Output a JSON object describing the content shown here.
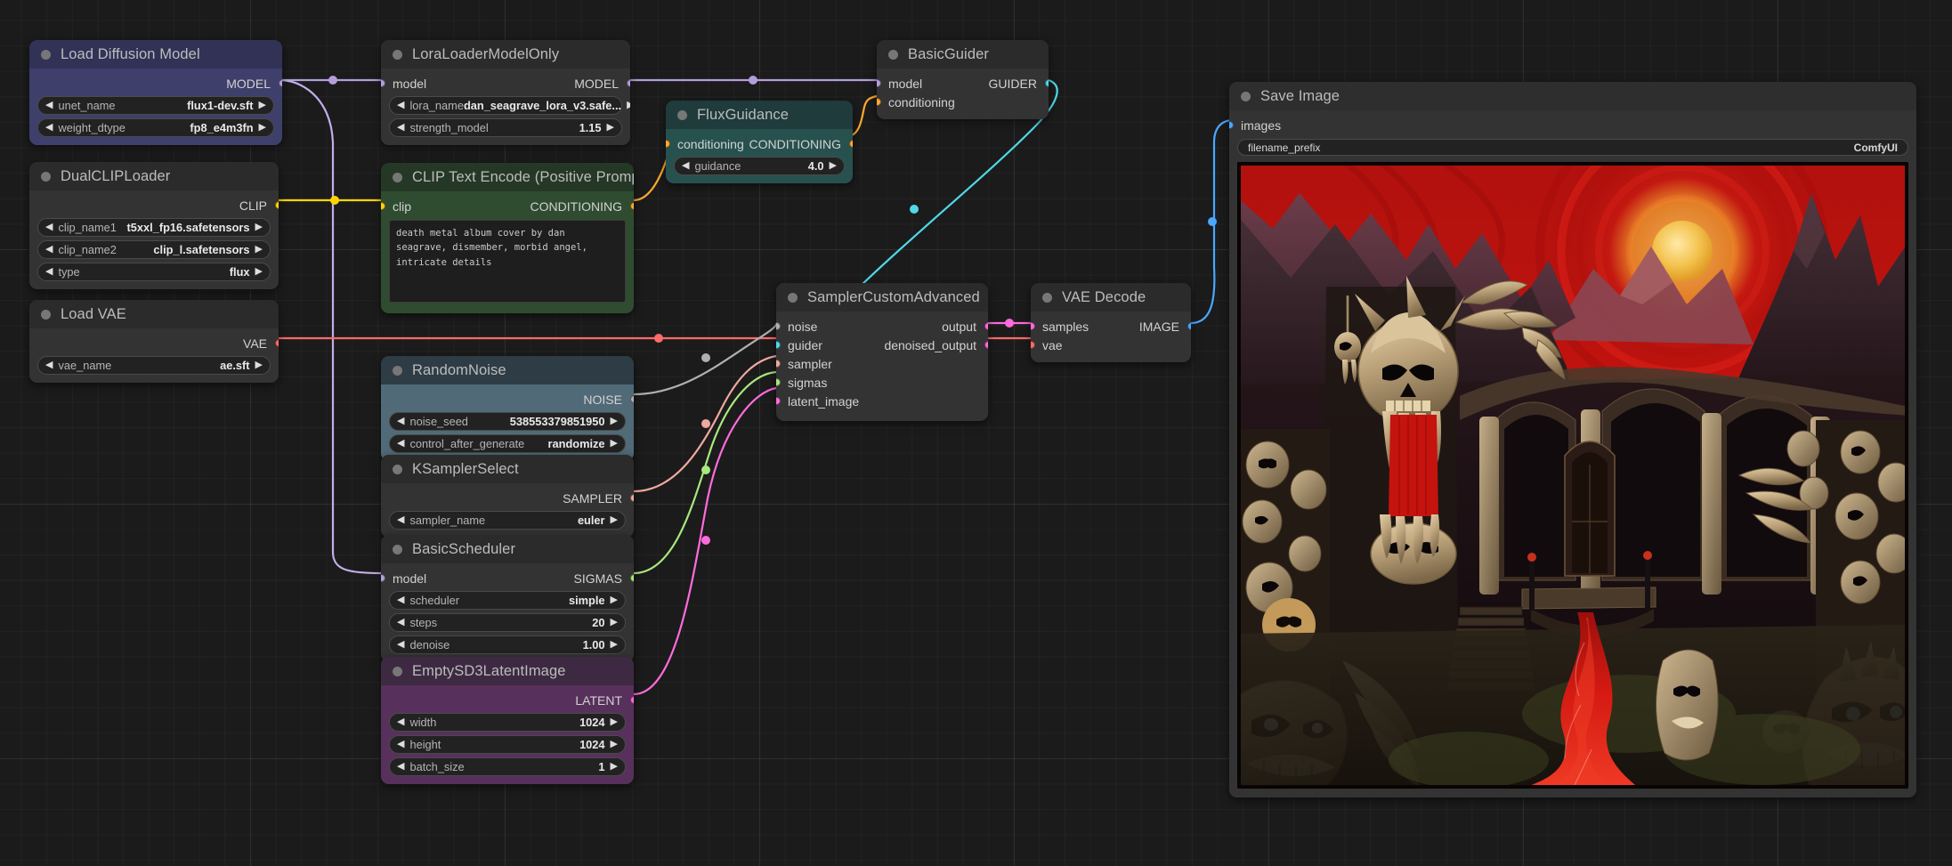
{
  "app": {
    "name": "ComfyUI",
    "canvas_bg": "#1b1b1b"
  },
  "nodes": {
    "load_diffusion_model": {
      "title": "Load Diffusion Model",
      "outputs": [
        {
          "label": "MODEL",
          "color": "#b39ddb"
        }
      ],
      "widgets": [
        {
          "name": "unet_name",
          "value": "flux1-dev.sft"
        },
        {
          "name": "weight_dtype",
          "value": "fp8_e4m3fn"
        }
      ]
    },
    "dual_clip_loader": {
      "title": "DualCLIPLoader",
      "outputs": [
        {
          "label": "CLIP",
          "color": "#ffd500"
        }
      ],
      "widgets": [
        {
          "name": "clip_name1",
          "value": "t5xxl_fp16.safetensors"
        },
        {
          "name": "clip_name2",
          "value": "clip_l.safetensors"
        },
        {
          "name": "type",
          "value": "flux"
        }
      ]
    },
    "load_vae": {
      "title": "Load VAE",
      "outputs": [
        {
          "label": "VAE",
          "color": "#ff6b6b"
        }
      ],
      "widgets": [
        {
          "name": "vae_name",
          "value": "ae.sft"
        }
      ]
    },
    "lora_loader": {
      "title": "LoraLoaderModelOnly",
      "inputs": [
        {
          "label": "model",
          "color": "#b39ddb"
        }
      ],
      "outputs": [
        {
          "label": "MODEL",
          "color": "#b39ddb"
        }
      ],
      "widgets": [
        {
          "name": "lora_name",
          "value": "dan_seagrave_lora_v3.safe..."
        },
        {
          "name": "strength_model",
          "value": "1.15"
        }
      ]
    },
    "clip_text_encode": {
      "title": "CLIP Text Encode (Positive Prompt)",
      "inputs": [
        {
          "label": "clip",
          "color": "#ffd500"
        }
      ],
      "outputs": [
        {
          "label": "CONDITIONING",
          "color": "#ffa931"
        }
      ],
      "prompt": "death metal album cover by dan seagrave, dismember, morbid angel, intricate details"
    },
    "flux_guidance": {
      "title": "FluxGuidance",
      "inputs": [
        {
          "label": "conditioning",
          "color": "#ffa931"
        }
      ],
      "outputs": [
        {
          "label": "CONDITIONING",
          "color": "#ffa931"
        }
      ],
      "widgets": [
        {
          "name": "guidance",
          "value": "4.0"
        }
      ]
    },
    "basic_guider": {
      "title": "BasicGuider",
      "inputs": [
        {
          "label": "model",
          "color": "#b39ddb"
        },
        {
          "label": "conditioning",
          "color": "#ffa931"
        }
      ],
      "outputs": [
        {
          "label": "GUIDER",
          "color": "#4fd8e8"
        }
      ]
    },
    "random_noise": {
      "title": "RandomNoise",
      "outputs": [
        {
          "label": "NOISE",
          "color": "#b0b0b0"
        }
      ],
      "widgets": [
        {
          "name": "noise_seed",
          "value": "538553379851950"
        },
        {
          "name": "control_after_generate",
          "value": "randomize"
        }
      ]
    },
    "ksampler_select": {
      "title": "KSamplerSelect",
      "outputs": [
        {
          "label": "SAMPLER",
          "color": "#f0a9a0"
        }
      ],
      "widgets": [
        {
          "name": "sampler_name",
          "value": "euler"
        }
      ]
    },
    "basic_scheduler": {
      "title": "BasicScheduler",
      "inputs": [
        {
          "label": "model",
          "color": "#b39ddb"
        }
      ],
      "outputs": [
        {
          "label": "SIGMAS",
          "color": "#a9e77f"
        }
      ],
      "widgets": [
        {
          "name": "scheduler",
          "value": "simple"
        },
        {
          "name": "steps",
          "value": "20"
        },
        {
          "name": "denoise",
          "value": "1.00"
        }
      ]
    },
    "empty_latent": {
      "title": "EmptySD3LatentImage",
      "outputs": [
        {
          "label": "LATENT",
          "color": "#ff6bdc"
        }
      ],
      "widgets": [
        {
          "name": "width",
          "value": "1024"
        },
        {
          "name": "height",
          "value": "1024"
        },
        {
          "name": "batch_size",
          "value": "1"
        }
      ]
    },
    "sampler_custom_advanced": {
      "title": "SamplerCustomAdvanced",
      "inputs": [
        {
          "label": "noise",
          "color": "#b0b0b0"
        },
        {
          "label": "guider",
          "color": "#4fd8e8"
        },
        {
          "label": "sampler",
          "color": "#f0a9a0"
        },
        {
          "label": "sigmas",
          "color": "#a9e77f"
        },
        {
          "label": "latent_image",
          "color": "#ff6bdc"
        }
      ],
      "outputs": [
        {
          "label": "output",
          "color": "#ff6bdc"
        },
        {
          "label": "denoised_output",
          "color": "#ff6bdc"
        }
      ]
    },
    "vae_decode": {
      "title": "VAE Decode",
      "inputs": [
        {
          "label": "samples",
          "color": "#ff6bdc"
        },
        {
          "label": "vae",
          "color": "#ff6b6b"
        }
      ],
      "outputs": [
        {
          "label": "IMAGE",
          "color": "#4aa8ff"
        }
      ]
    },
    "save_image": {
      "title": "Save Image",
      "inputs": [
        {
          "label": "images",
          "color": "#4aa8ff"
        }
      ],
      "widgets": [
        {
          "name": "filename_prefix",
          "value": "ComfyUI"
        }
      ],
      "preview_alt": "Generated death metal album cover artwork: red sky with glowing sun, dark jagged mountains, ornate bone cathedral archways, giant fanged skulls, a flowing river of blood"
    }
  },
  "arrows": {
    "left": "◀",
    "right": "▶"
  }
}
